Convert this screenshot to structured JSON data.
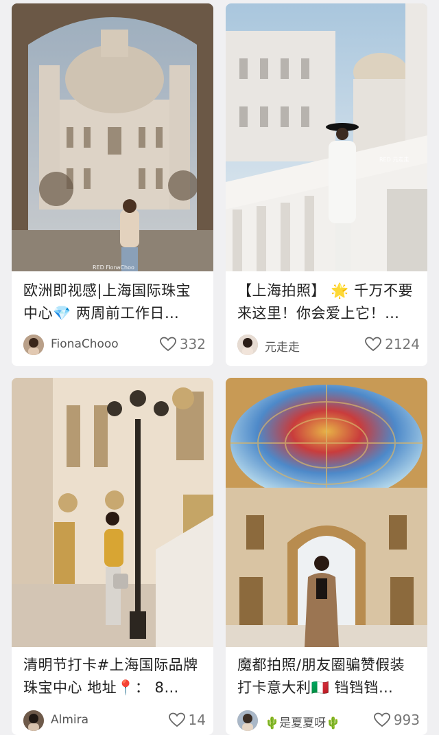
{
  "feed": {
    "cards": [
      {
        "title": "欧洲即视感|上海国际珠宝中心💎 两周前工作日…",
        "author": "FionaChooo",
        "likes": "332",
        "watermark": "RED FionaChoo"
      },
      {
        "title": "【上海拍照】 🌟 千万不要来这里！你会爱上它！…",
        "author": "元走走",
        "likes": "2124",
        "watermark": "RED 元走走"
      },
      {
        "title": "清明节打卡#上海国际品牌珠宝中心 地址📍： 8…",
        "author": "Almira",
        "likes": "14"
      },
      {
        "title": "魔都拍照/朋友圈骗赞假装打卡意大利🇮🇹 铛铛铛…",
        "author": "🌵是夏夏呀🌵",
        "likes": "993"
      }
    ]
  },
  "icons": {
    "like": "heart-outline-icon"
  },
  "colors": {
    "background": "#f0f0f2",
    "card": "#ffffff",
    "title_text": "#222222",
    "meta_text": "#777777"
  }
}
